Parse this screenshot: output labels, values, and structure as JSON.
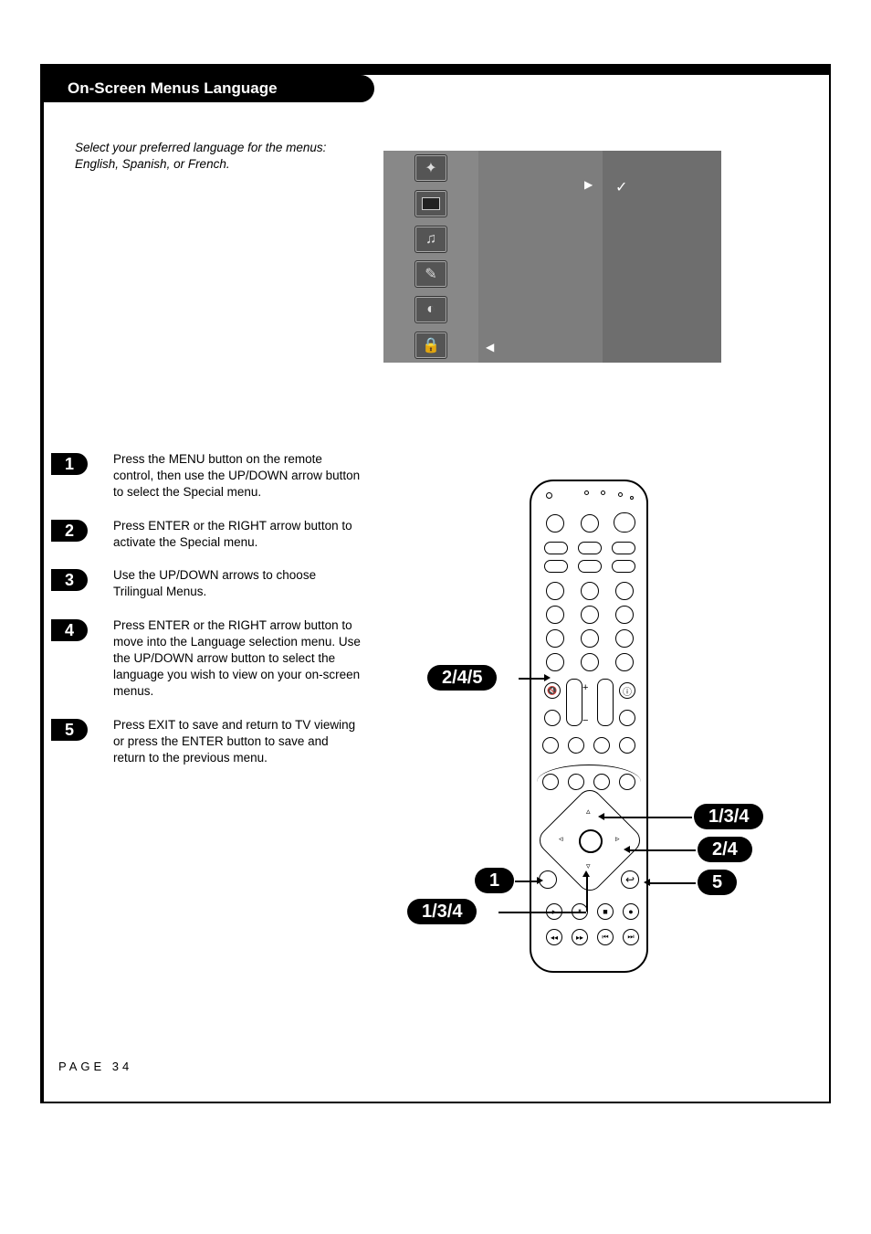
{
  "title": "On-Screen Menus Language",
  "intro": "Select your preferred language for the menus: English, Spanish, or French.",
  "osd": {
    "icons": [
      "satellite-icon",
      "tv-icon",
      "speaker-icon",
      "clock-icon",
      "special-icon",
      "lock-icon"
    ],
    "right_arrow": "▶",
    "left_arrow": "◀",
    "check": "✓"
  },
  "steps": [
    {
      "n": "1",
      "text": "Press the MENU button on the remote control, then use the UP/DOWN arrow button to select the Special menu."
    },
    {
      "n": "2",
      "text": "Press ENTER or the RIGHT arrow button to activate the Special menu."
    },
    {
      "n": "3",
      "text": "Use the UP/DOWN arrows to choose Trilingual Menus."
    },
    {
      "n": "4",
      "text": "Press ENTER or the RIGHT arrow button to move into the Language selection menu. Use the UP/DOWN arrow button to select the language you wish to view on your on-screen menus."
    },
    {
      "n": "5",
      "text": "Press EXIT to save and return to TV viewing or press the ENTER button to save and return to the previous menu."
    }
  ],
  "callouts": {
    "left_mid": "2/4/5",
    "left_menu": "1",
    "left_updown": "1/3/4",
    "right_updown": "1/3/4",
    "right_enter": "2/4",
    "right_exit": "5"
  },
  "remote": {
    "dpad_glyphs": {
      "up": "▵",
      "down": "▿",
      "left": "◃",
      "right": "▹",
      "center": "◎"
    },
    "rocker_plus": "+",
    "rocker_minus": "−",
    "transport": {
      "play": "▸",
      "pause": "⏸",
      "stop": "■",
      "rec": "●",
      "rew": "◂◂",
      "ff": "▸▸",
      "prev": "⏮",
      "next": "⏭"
    },
    "mute": "🔇",
    "exit": "↩"
  },
  "page_label": "PAGE 34"
}
